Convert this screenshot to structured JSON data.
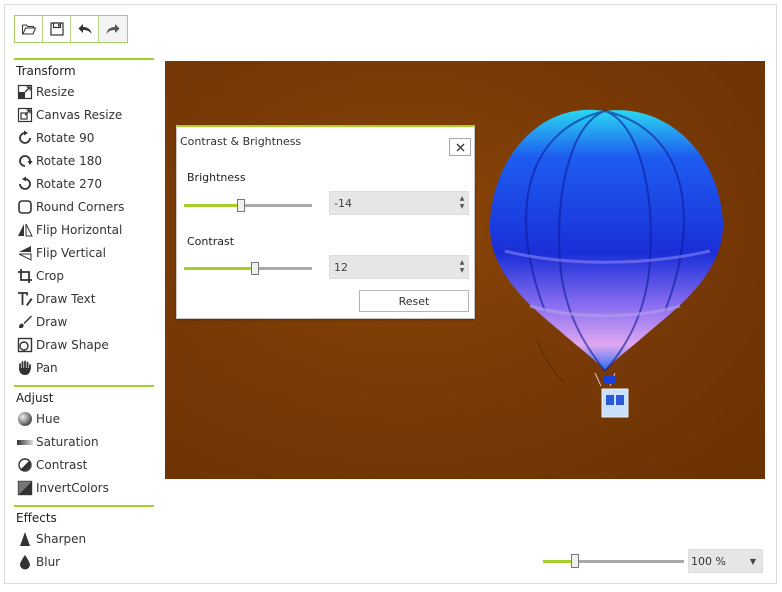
{
  "toolbar": {
    "buttons": [
      {
        "name": "open-button",
        "icon": "folder-open-icon"
      },
      {
        "name": "save-button",
        "icon": "save-icon"
      },
      {
        "name": "undo-button",
        "icon": "undo-icon"
      },
      {
        "name": "redo-button",
        "icon": "redo-icon"
      }
    ]
  },
  "sidebar": {
    "transform": {
      "title": "Transform",
      "items": [
        {
          "label": "Resize",
          "icon": "resize-icon"
        },
        {
          "label": "Canvas Resize",
          "icon": "canvas-resize-icon"
        },
        {
          "label": "Rotate 90",
          "icon": "rotate-90-icon"
        },
        {
          "label": "Rotate 180",
          "icon": "rotate-180-icon"
        },
        {
          "label": "Rotate 270",
          "icon": "rotate-270-icon"
        },
        {
          "label": "Round Corners",
          "icon": "round-corners-icon"
        },
        {
          "label": "Flip Horizontal",
          "icon": "flip-horizontal-icon"
        },
        {
          "label": "Flip Vertical",
          "icon": "flip-vertical-icon"
        },
        {
          "label": "Crop",
          "icon": "crop-icon"
        },
        {
          "label": "Draw Text",
          "icon": "draw-text-icon"
        },
        {
          "label": "Draw",
          "icon": "draw-icon"
        },
        {
          "label": "Draw Shape",
          "icon": "draw-shape-icon"
        },
        {
          "label": "Pan",
          "icon": "pan-hand-icon"
        }
      ]
    },
    "adjust": {
      "title": "Adjust",
      "items": [
        {
          "label": "Hue",
          "icon": "hue-icon"
        },
        {
          "label": "Saturation",
          "icon": "saturation-icon"
        },
        {
          "label": "Contrast",
          "icon": "contrast-icon"
        },
        {
          "label": "InvertColors",
          "icon": "invert-colors-icon"
        }
      ]
    },
    "effects": {
      "title": "Effects",
      "items": [
        {
          "label": "Sharpen",
          "icon": "sharpen-icon"
        },
        {
          "label": "Blur",
          "icon": "blur-icon"
        }
      ]
    }
  },
  "dialog": {
    "title": "Contrast & Brightness",
    "brightness": {
      "label": "Brightness",
      "value": "-14",
      "slider_fraction": 0.44
    },
    "contrast": {
      "label": "Contrast",
      "value": "12",
      "slider_fraction": 0.56
    },
    "reset_label": "Reset"
  },
  "zoom": {
    "value": "100 %",
    "slider_fraction": 0.21
  },
  "colors": {
    "accent": "#a3d12a",
    "canvas_background": "#7a3a06"
  }
}
